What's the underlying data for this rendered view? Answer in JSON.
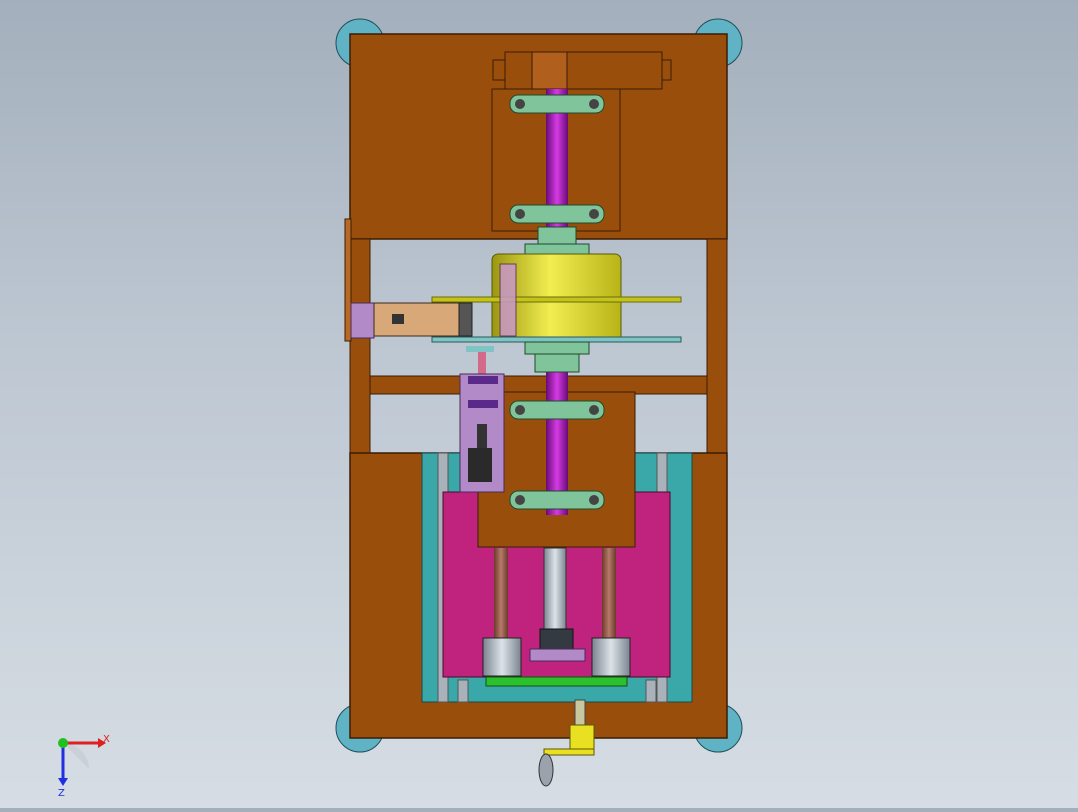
{
  "viewport": {
    "background_top": "#a3afbc",
    "background_bottom": "#d6dde4"
  },
  "colors": {
    "frame_brown": "#9a4e0c",
    "frame_edge": "#3a1c04",
    "magenta_plate": "#c0237e",
    "teal_plate": "#3aa7a8",
    "green_bracket": "#7fc49a",
    "purple_shaft": "#b01cc0",
    "yellow_drum": "#d8d420",
    "caster_blue": "#5fb3c4",
    "lavender_block": "#b28ac8",
    "beige_arm": "#d8a878"
  },
  "triad": {
    "x_label": "X",
    "z_label": "Z",
    "x_color": "#e02020",
    "y_color": "#20c020",
    "z_color": "#2030e0"
  }
}
